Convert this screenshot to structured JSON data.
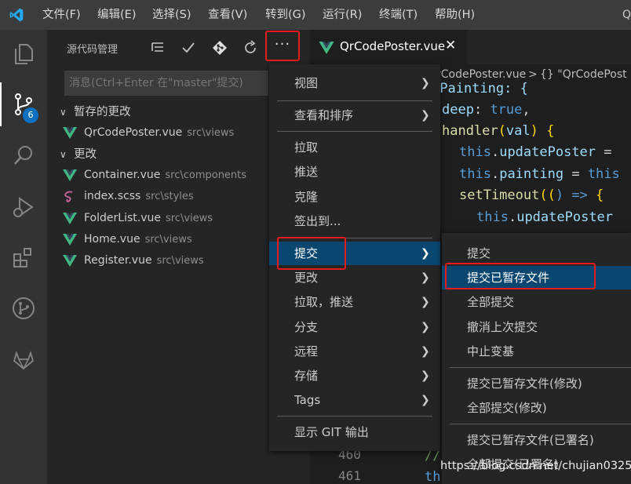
{
  "menubar": {
    "items": [
      "文件(F)",
      "编辑(E)",
      "选择(S)",
      "查看(V)",
      "转到(G)",
      "运行(R)",
      "终端(T)",
      "帮助(H)"
    ],
    "right_text": "Q"
  },
  "activity": {
    "badge": "6"
  },
  "scm": {
    "title": "源代码管理",
    "more_label": "···",
    "message_placeholder": "消息(Ctrl+Enter 在\"master\"提交)",
    "staged_group": "暂存的更改",
    "changes_group": "更改",
    "staged_files": [
      {
        "name": "QrCodePoster.vue",
        "path": "src\\views"
      }
    ],
    "changed_files": [
      {
        "name": "Container.vue",
        "path": "src\\components"
      },
      {
        "name": "index.scss",
        "path": "src\\styles"
      },
      {
        "name": "FolderList.vue",
        "path": "src\\views"
      },
      {
        "name": "Home.vue",
        "path": "src\\views"
      },
      {
        "name": "Register.vue",
        "path": "src\\views"
      }
    ]
  },
  "editor": {
    "tab_title": "QrCodePoster.vue",
    "tab_close": "✕",
    "breadcrumb_file": "QrCodePoster.vue",
    "breadcrumb_sep": ">",
    "breadcrumb_symbol": "{} \"QrCodePost",
    "line_numbers": [
      "460",
      "461"
    ],
    "code": {
      "l1": "wPainting: {",
      "l2a": "deep",
      "l2b": ": ",
      "l2c": "true",
      "l2d": ",",
      "l3a": "handler",
      "l3b": "(",
      "l3c": "val",
      "l3d": ") ",
      "l3e": "{",
      "l4a": "this",
      "l4b": ".",
      "l4c": "updatePoster",
      "l4d": " =",
      "l5a": "this",
      "l5b": ".",
      "l5c": "painting",
      "l5d": " = ",
      "l5e": "this",
      "l6a": "setTimeout",
      "l6b": "((",
      "l6c": ") => ",
      "l6d": "{",
      "l7a": "this",
      "l7b": ".",
      "l7c": "updatePoster",
      "l8": "//",
      "l9": "th"
    }
  },
  "menu_main": {
    "items": [
      "视图",
      "查看和排序",
      "拉取",
      "推送",
      "克隆",
      "签出到...",
      "提交",
      "更改",
      "拉取，推送",
      "分支",
      "远程",
      "存储",
      "Tags",
      "显示 GIT 输出"
    ]
  },
  "menu_sub": {
    "items": [
      "提交",
      "提交已暂存文件",
      "全部提交",
      "撤消上次提交",
      "中止变基",
      "提交已暂存文件(修改)",
      "全部提交(修改)",
      "提交已暂存文件(已署名)",
      "全部提交(已署名)"
    ]
  },
  "watermark": "https://blog.csdn.net/chujian0325",
  "colors": {
    "accent_blue": "#0e70c0",
    "selection": "#094771",
    "highlight_red": "#e51c1c",
    "vue_green": "#41b883"
  }
}
